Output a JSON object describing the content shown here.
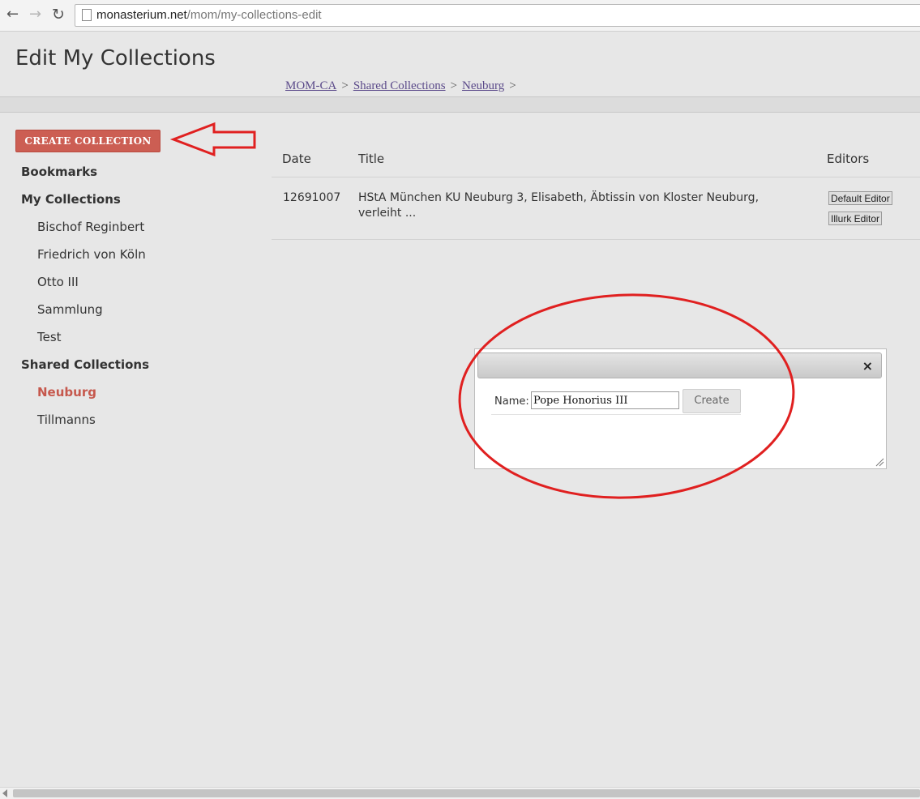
{
  "browser": {
    "url_host": "monasterium.net",
    "url_path": "/mom/my-collections-edit",
    "back_icon": "arrow-left-icon",
    "forward_icon": "arrow-right-icon",
    "reload_icon": "reload-icon"
  },
  "header": {
    "title": "Edit My Collections",
    "breadcrumb": {
      "items": [
        "MOM-CA",
        "Shared Collections",
        "Neuburg"
      ],
      "separator": ">"
    }
  },
  "sidebar": {
    "create_button": "CREATE COLLECTION",
    "bookmarks": "Bookmarks",
    "my_collections": {
      "label": "My Collections",
      "items": [
        "Bischof Reginbert",
        "Friedrich von Köln",
        "Otto III",
        "Sammlung",
        "Test"
      ]
    },
    "shared_collections": {
      "label": "Shared Collections",
      "items": [
        "Neuburg",
        "Tillmanns"
      ],
      "active": "Neuburg"
    }
  },
  "table": {
    "headers": {
      "date": "Date",
      "title": "Title",
      "editors": "Editors"
    },
    "rows": [
      {
        "date": "12691007",
        "title_line1": "HStA München KU Neuburg 3, Elisabeth, Äbtissin von Kloster Neuburg,",
        "title_line2": "verleiht ...",
        "editors": [
          "Default Editor",
          "Illurk Editor"
        ]
      }
    ]
  },
  "dialog": {
    "close_glyph": "×",
    "name_label": "Name:",
    "name_value": "Pope Honorius III",
    "create_label": "Create"
  },
  "colors": {
    "accent": "#cc5e53",
    "active_link": "#c6584d",
    "breadcrumb_link": "#5b4a8a",
    "annotation": "#e02020",
    "page_background": "#e7e7e7"
  }
}
